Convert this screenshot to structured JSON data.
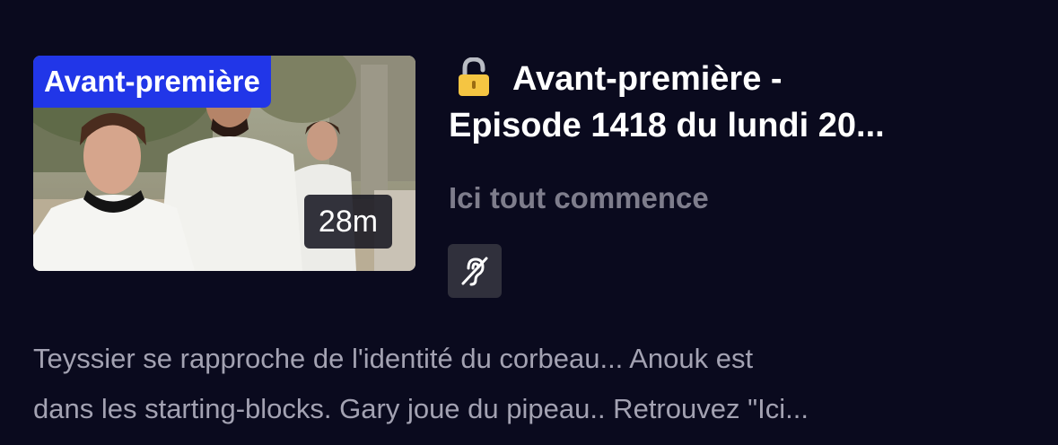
{
  "episode": {
    "badge_label": "Avant-première",
    "duration": "28m",
    "title_line1": "Avant-première -",
    "title_line2": "Episode 1418 du lundi 20...",
    "show_name": "Ici tout commence",
    "description_line1": "Teyssier se rapproche de l'identité du corbeau... Anouk est",
    "description_line2": "dans les starting-blocks. Gary joue du pipeau.. Retrouvez \"Ici..."
  },
  "icons": {
    "lock": "lock-icon",
    "accessibility": "hearing-impaired-icon"
  },
  "colors": {
    "background": "#0a0a1e",
    "badge_blue": "#2136e8",
    "lock_yellow": "#f5c542",
    "muted_text": "#7e7d8c"
  }
}
